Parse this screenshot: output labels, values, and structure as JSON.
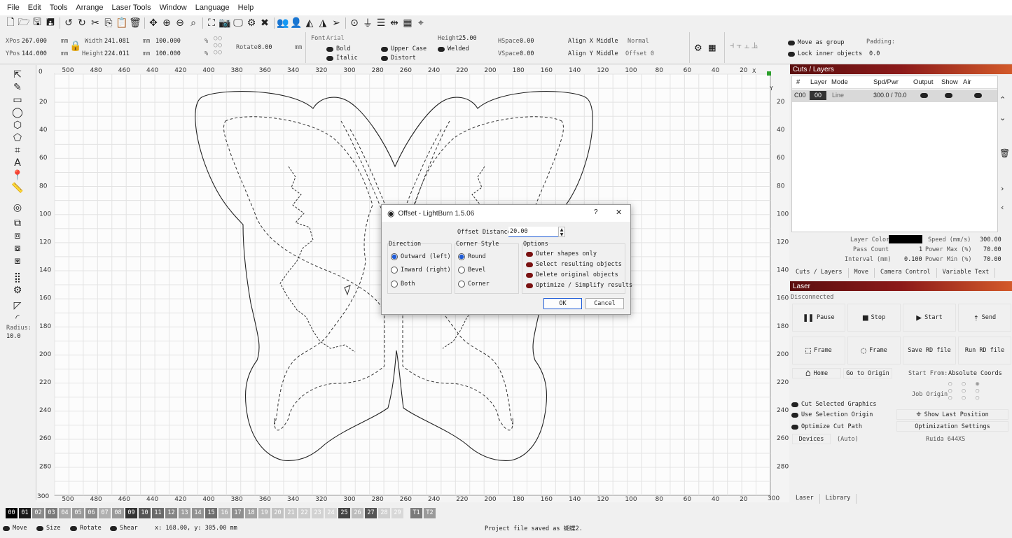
{
  "menu": [
    "File",
    "Edit",
    "Tools",
    "Arrange",
    "Laser Tools",
    "Window",
    "Language",
    "Help"
  ],
  "toolbar_icons": [
    "new-icon",
    "open-icon",
    "save-icon",
    "save-as-icon",
    "undo-icon",
    "redo-icon",
    "cut-icon",
    "copy-icon",
    "paste-icon",
    "delete-icon",
    "move-icon",
    "zoom-in-icon",
    "zoom-out-icon",
    "zoom-fit-icon",
    "frame-icon",
    "camera-icon",
    "monitor-icon",
    "settings-icon",
    "tools-icon",
    "users-icon",
    "user-icon",
    "trace-icon",
    "mirror-icon",
    "send-icon",
    "target-icon",
    "align-icon",
    "distribute-icon",
    "spacing-icon",
    "grid-icon",
    "center-icon"
  ],
  "props": {
    "xpos_label": "XPos",
    "xpos": "267.000",
    "ypos_label": "YPos",
    "ypos": "144.000",
    "unit": "mm",
    "width_label": "Width",
    "width": "241.081",
    "height_label": "Height",
    "height": "224.011",
    "scale_w": "100.000",
    "scale_h": "100.000",
    "pct": "%",
    "rotate_label": "Rotate",
    "rotate": "0.00",
    "rotate_unit": "mm",
    "font_label": "Font",
    "font": "Arial",
    "height2_label": "Height",
    "height2": "25.00",
    "bold": "Bold",
    "italic": "Italic",
    "upper": "Upper Case",
    "welded": "Welded",
    "distort": "Distort",
    "hspace_label": "HSpace",
    "hspace": "0.00",
    "vspace_label": "VSpace",
    "vspace": "0.00",
    "alignx": "Align X Middle",
    "aligny": "Align Y Middle",
    "normal": "Normal",
    "offset": "Offset 0",
    "move_group": "Move as group",
    "lock_inner": "Lock inner objects",
    "padding_label": "Padding:",
    "padding": "0.0"
  },
  "left_tools": [
    "select-icon",
    "pen-icon",
    "rectangle-icon",
    "ellipse-icon",
    "polygon-icon",
    "path-icon",
    "position-icon",
    "text-icon",
    "marker-icon",
    "measure-icon",
    "offset-tool-icon",
    "boolean-union-icon",
    "boolean-subtract-icon",
    "boolean-intersect-icon",
    "weld-icon",
    "grid-array-icon",
    "circular-array-icon",
    "corner-icon",
    "round-corner-icon"
  ],
  "left_tools_extra": {
    "radius_label": "Radius:",
    "radius": "10.0"
  },
  "ruler": {
    "top": [
      "500",
      "480",
      "460",
      "440",
      "420",
      "400",
      "380",
      "360",
      "340",
      "320",
      "300",
      "280",
      "260",
      "240",
      "220",
      "200",
      "180",
      "160",
      "140",
      "120",
      "100",
      "80",
      "60",
      "40",
      "20"
    ],
    "side": [
      "20",
      "40",
      "60",
      "80",
      "100",
      "120",
      "140",
      "160",
      "180",
      "200",
      "220",
      "240",
      "260",
      "280"
    ],
    "corner_tl": "0",
    "corner_bl": "300",
    "corner_br": "300",
    "x_mark": "X",
    "y_mark": "Y"
  },
  "layers_bar": [
    {
      "label": "00",
      "color": "#000000"
    },
    {
      "label": "01",
      "color": "#1a1a1a"
    },
    {
      "label": "02",
      "color": "#8a8a8a"
    },
    {
      "label": "03",
      "color": "#7a7a7a"
    },
    {
      "label": "04",
      "color": "#a8a8a8"
    },
    {
      "label": "05",
      "color": "#9a9a9a"
    },
    {
      "label": "06",
      "color": "#8c8c8c"
    },
    {
      "label": "07",
      "color": "#b0b0b0"
    },
    {
      "label": "08",
      "color": "#999999"
    },
    {
      "label": "09",
      "color": "#333333"
    },
    {
      "label": "10",
      "color": "#555555"
    },
    {
      "label": "11",
      "color": "#6a6a6a"
    },
    {
      "label": "12",
      "color": "#858585"
    },
    {
      "label": "13",
      "color": "#a0a0a0"
    },
    {
      "label": "14",
      "color": "#929292"
    },
    {
      "label": "15",
      "color": "#6e6e6e"
    },
    {
      "label": "16",
      "color": "#b5b5b5"
    },
    {
      "label": "17",
      "color": "#8f8f8f"
    },
    {
      "label": "18",
      "color": "#a3a3a3"
    },
    {
      "label": "19",
      "color": "#bababa"
    },
    {
      "label": "20",
      "color": "#c2c2c2"
    },
    {
      "label": "21",
      "color": "#c8c8c8"
    },
    {
      "label": "22",
      "color": "#cccccc"
    },
    {
      "label": "23",
      "color": "#d2d2d2"
    },
    {
      "label": "24",
      "color": "#d6d6d6"
    },
    {
      "label": "25",
      "color": "#444444"
    },
    {
      "label": "26",
      "color": "#bdbdbd"
    },
    {
      "label": "27",
      "color": "#555555"
    },
    {
      "label": "28",
      "color": "#cfcfcf"
    },
    {
      "label": "29",
      "color": "#d8d8d8"
    },
    {
      "label": "T1",
      "color": "#7a7a7a"
    },
    {
      "label": "T2",
      "color": "#9a9a9a"
    }
  ],
  "status": {
    "move": "Move",
    "size": "Size",
    "rotate": "Rotate",
    "shear": "Shear",
    "coords": "x: 168.00, y: 305.00 mm",
    "msg": "Project file saved as 蝴蝶2."
  },
  "cuts": {
    "title": "Cuts / Layers",
    "headers": [
      "#",
      "Layer",
      "Mode",
      "Spd/Pwr",
      "Output",
      "Show",
      "Air"
    ],
    "row": {
      "num": "C00",
      "layer": "00",
      "mode": "Line",
      "spdpwr": "300.0 / 70.0"
    },
    "layer_color_label": "Layer Color",
    "speed_label": "Speed (mm/s)",
    "speed": "300.00",
    "pass_label": "Pass Count",
    "pass": "1",
    "pmax_label": "Power Max (%)",
    "pmax": "70.00",
    "interval_label": "Interval (mm)",
    "interval": "0.100",
    "pmin_label": "Power Min (%)",
    "pmin": "70.00",
    "tabs": [
      "Cuts / Layers",
      "Move",
      "Camera Control",
      "Variable Text"
    ]
  },
  "laser": {
    "title": "Laser",
    "status": "Disconnected",
    "buttons": [
      {
        "icon": "❚❚",
        "label": "Pause"
      },
      {
        "icon": "■",
        "label": "Stop"
      },
      {
        "icon": "▶",
        "label": "Start"
      },
      {
        "icon": "⇡",
        "label": "Send"
      },
      {
        "icon": "⬚",
        "label": "Frame"
      },
      {
        "icon": "◌",
        "label": "Frame"
      },
      {
        "icon": "",
        "label": "Save RD file"
      },
      {
        "icon": "",
        "label": "Run RD file"
      }
    ],
    "home": "Home",
    "origin": "Go to Origin",
    "start_from_label": "Start From:",
    "start_from": "Absolute Coords",
    "job_origin": "Job Origin",
    "cut_sel": "Cut Selected Graphics",
    "use_sel": "Use Selection Origin",
    "optimize": "Optimize Cut Path",
    "show_last": "Show Last Position",
    "opt_settings": "Optimization Settings",
    "devices": "Devices",
    "auto": "(Auto)",
    "device": "Ruida 644XS",
    "tabs": [
      "Laser",
      "Library"
    ]
  },
  "dialog": {
    "title": "Offset - LightBurn 1.5.06",
    "help": "?",
    "close": "✕",
    "distance_label": "Offset Distance",
    "distance": "20.00",
    "direction_label": "Direction",
    "directions": [
      "Outward (left)",
      "Inward (right)",
      "Both"
    ],
    "corner_label": "Corner Style",
    "corners": [
      "Round",
      "Bevel",
      "Corner"
    ],
    "options_label": "Options",
    "options": [
      "Outer shapes only",
      "Select resulting objects",
      "Delete original objects",
      "Optimize / Simplify results"
    ],
    "ok": "OK",
    "cancel": "Cancel"
  }
}
